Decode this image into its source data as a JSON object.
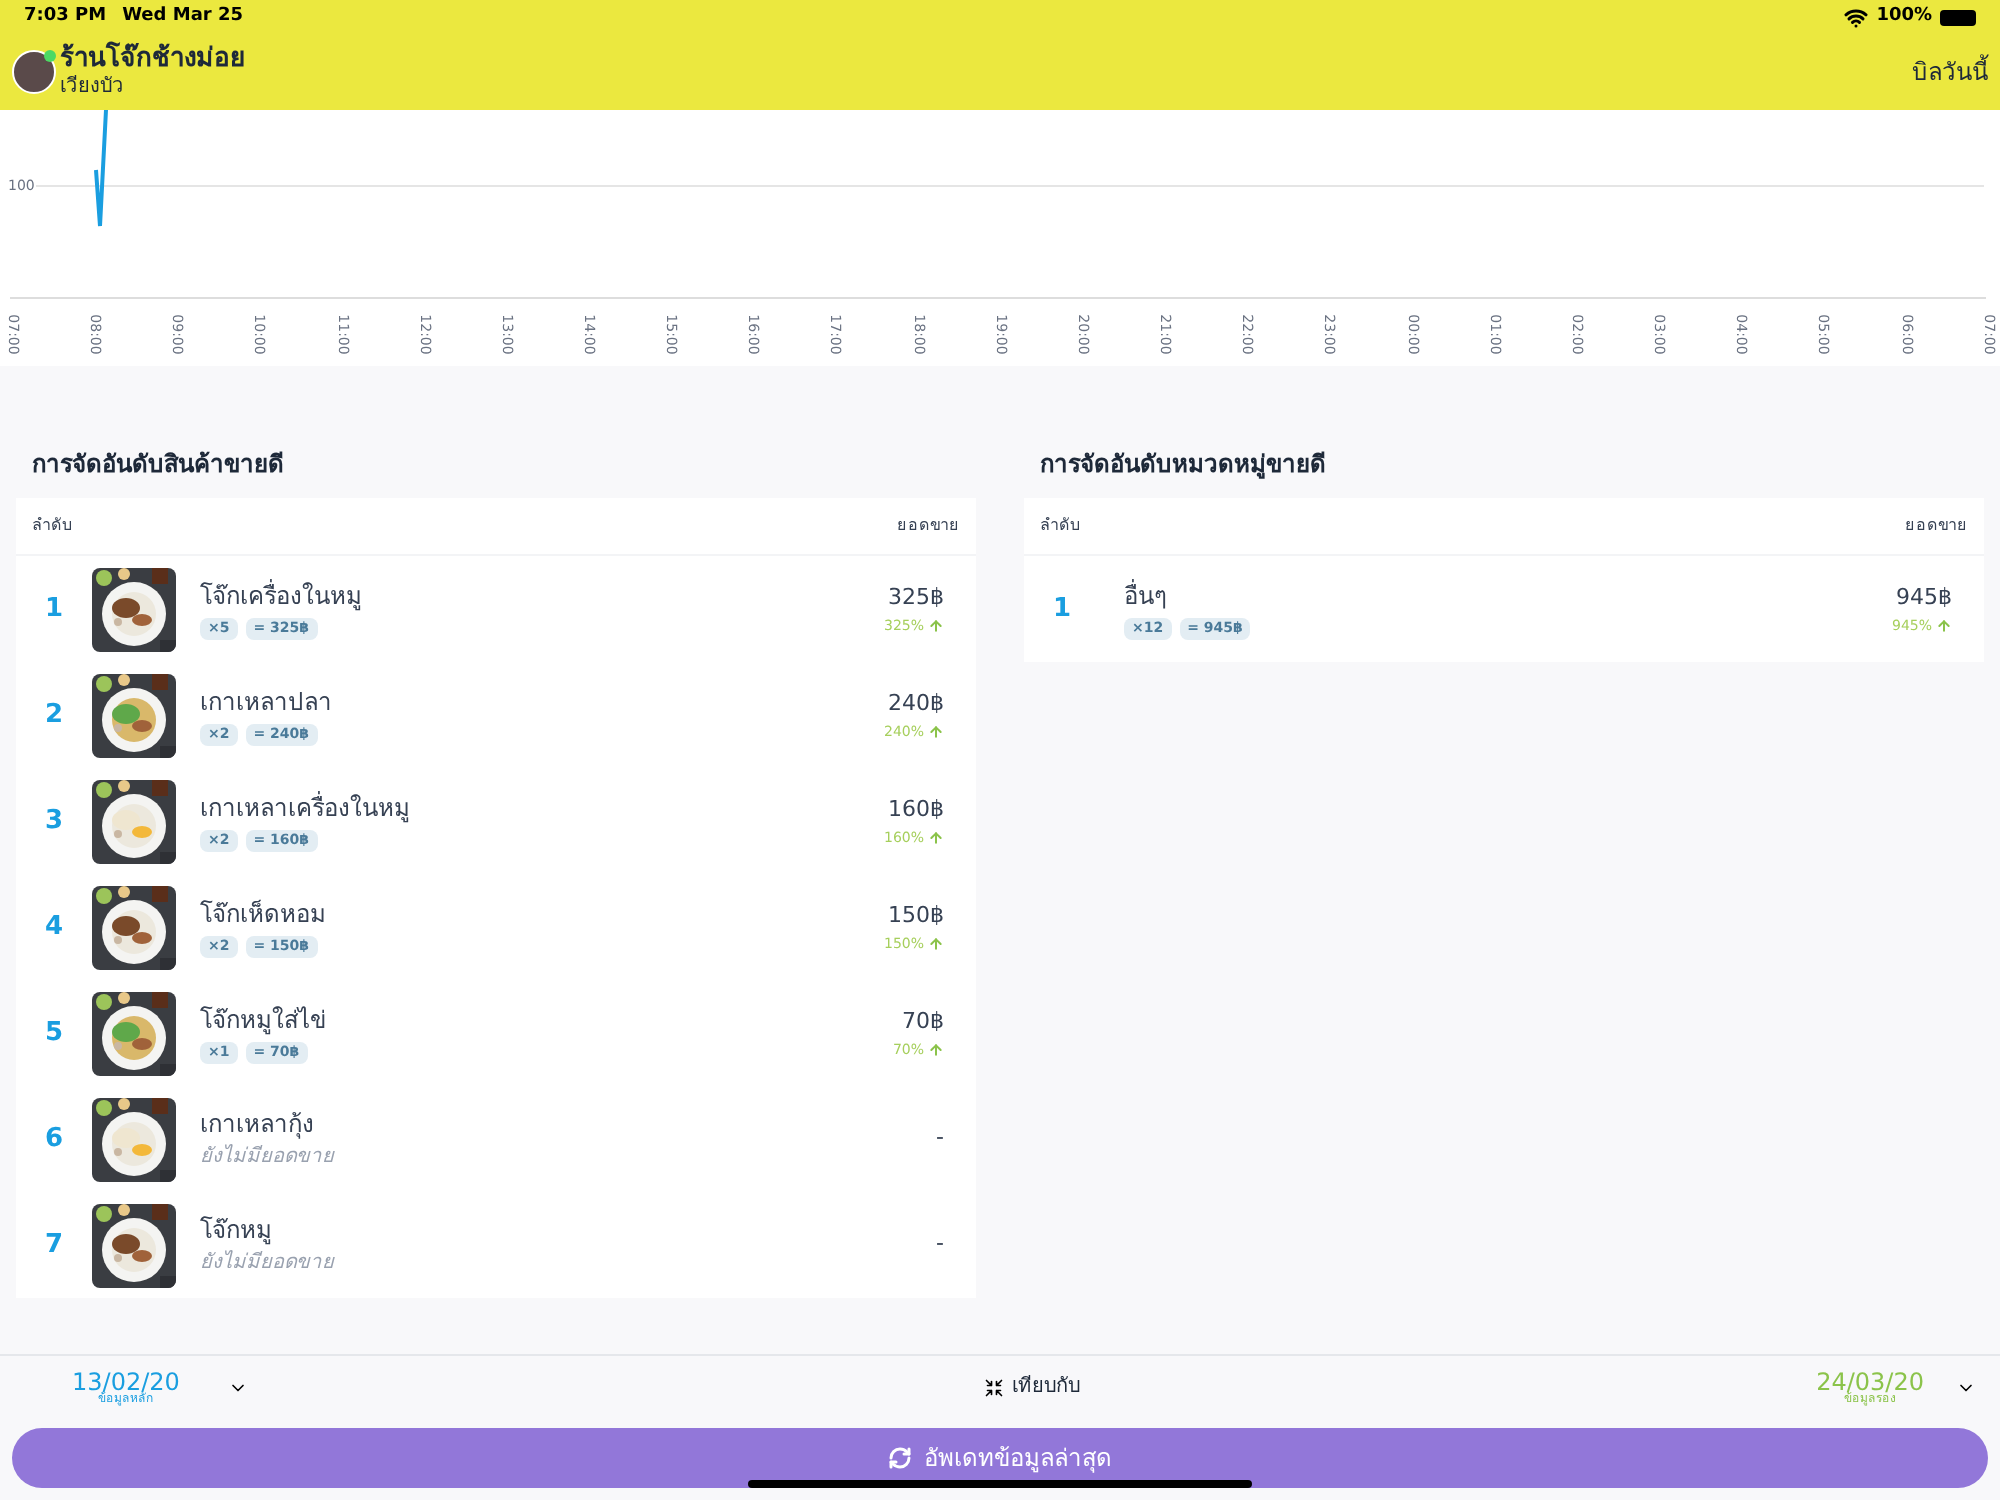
{
  "status_bar": {
    "time": "7:03 PM",
    "date": "Wed Mar 25",
    "battery": "100%"
  },
  "header": {
    "shop_name": "ร้านโจ๊กช้างม่อย",
    "branch": "เวียงบัว",
    "action": "บิลวันนี้"
  },
  "chart": {
    "y_tick": "100",
    "x_labels": [
      "07:00",
      "08:00",
      "09:00",
      "10:00",
      "11:00",
      "12:00",
      "13:00",
      "14:00",
      "15:00",
      "16:00",
      "17:00",
      "18:00",
      "19:00",
      "20:00",
      "21:00",
      "22:00",
      "23:00",
      "00:00",
      "01:00",
      "02:00",
      "03:00",
      "04:00",
      "05:00",
      "06:00",
      "07:00"
    ]
  },
  "product_ranking": {
    "title": "การจัดอันดับสินค้าขายดี",
    "col_rank": "ลำดับ",
    "col_sales": "ยอดขาย",
    "rows": [
      {
        "kind": "sold",
        "rank": "1",
        "name": "โจ๊กเครื่องในหมู",
        "qty": "×5",
        "sum": "= 325฿",
        "amount": "325฿",
        "percent": "325%"
      },
      {
        "kind": "sold",
        "rank": "2",
        "name": "เกาเหลาปลา",
        "qty": "×2",
        "sum": "= 240฿",
        "amount": "240฿",
        "percent": "240%"
      },
      {
        "kind": "sold",
        "rank": "3",
        "name": "เกาเหลาเครื่องในหมู",
        "qty": "×2",
        "sum": "= 160฿",
        "amount": "160฿",
        "percent": "160%"
      },
      {
        "kind": "sold",
        "rank": "4",
        "name": "โจ๊กเห็ดหอม",
        "qty": "×2",
        "sum": "= 150฿",
        "amount": "150฿",
        "percent": "150%"
      },
      {
        "kind": "sold",
        "rank": "5",
        "name": "โจ๊กหมูใส่ไข่",
        "qty": "×1",
        "sum": "= 70฿",
        "amount": "70฿",
        "percent": "70%"
      },
      {
        "kind": "none",
        "rank": "6",
        "name": "เกาเหลากุ้ง",
        "note": "ยังไม่มียอดขาย",
        "amount": "-"
      },
      {
        "kind": "none",
        "rank": "7",
        "name": "โจ๊กหมู",
        "note": "ยังไม่มียอดขาย",
        "amount": "-"
      }
    ]
  },
  "category_ranking": {
    "title": "การจัดอันดับหมวดหมู่ขายดี",
    "col_rank": "ลำดับ",
    "col_sales": "ยอดขาย",
    "rows": [
      {
        "kind": "sold",
        "rank": "1",
        "name": "อื่นๆ",
        "qty": "×12",
        "sum": "= 945฿",
        "amount": "945฿",
        "percent": "945%"
      }
    ]
  },
  "compare_bar": {
    "primary_date": "13/02/20",
    "primary_label": "ข้อมูลหลัก",
    "compare_label": "เทียบกับ",
    "secondary_date": "24/03/20",
    "secondary_label": "ข้อมูลรอง"
  },
  "update_button": "อัพเดทข้อมูลล่าสุด"
}
